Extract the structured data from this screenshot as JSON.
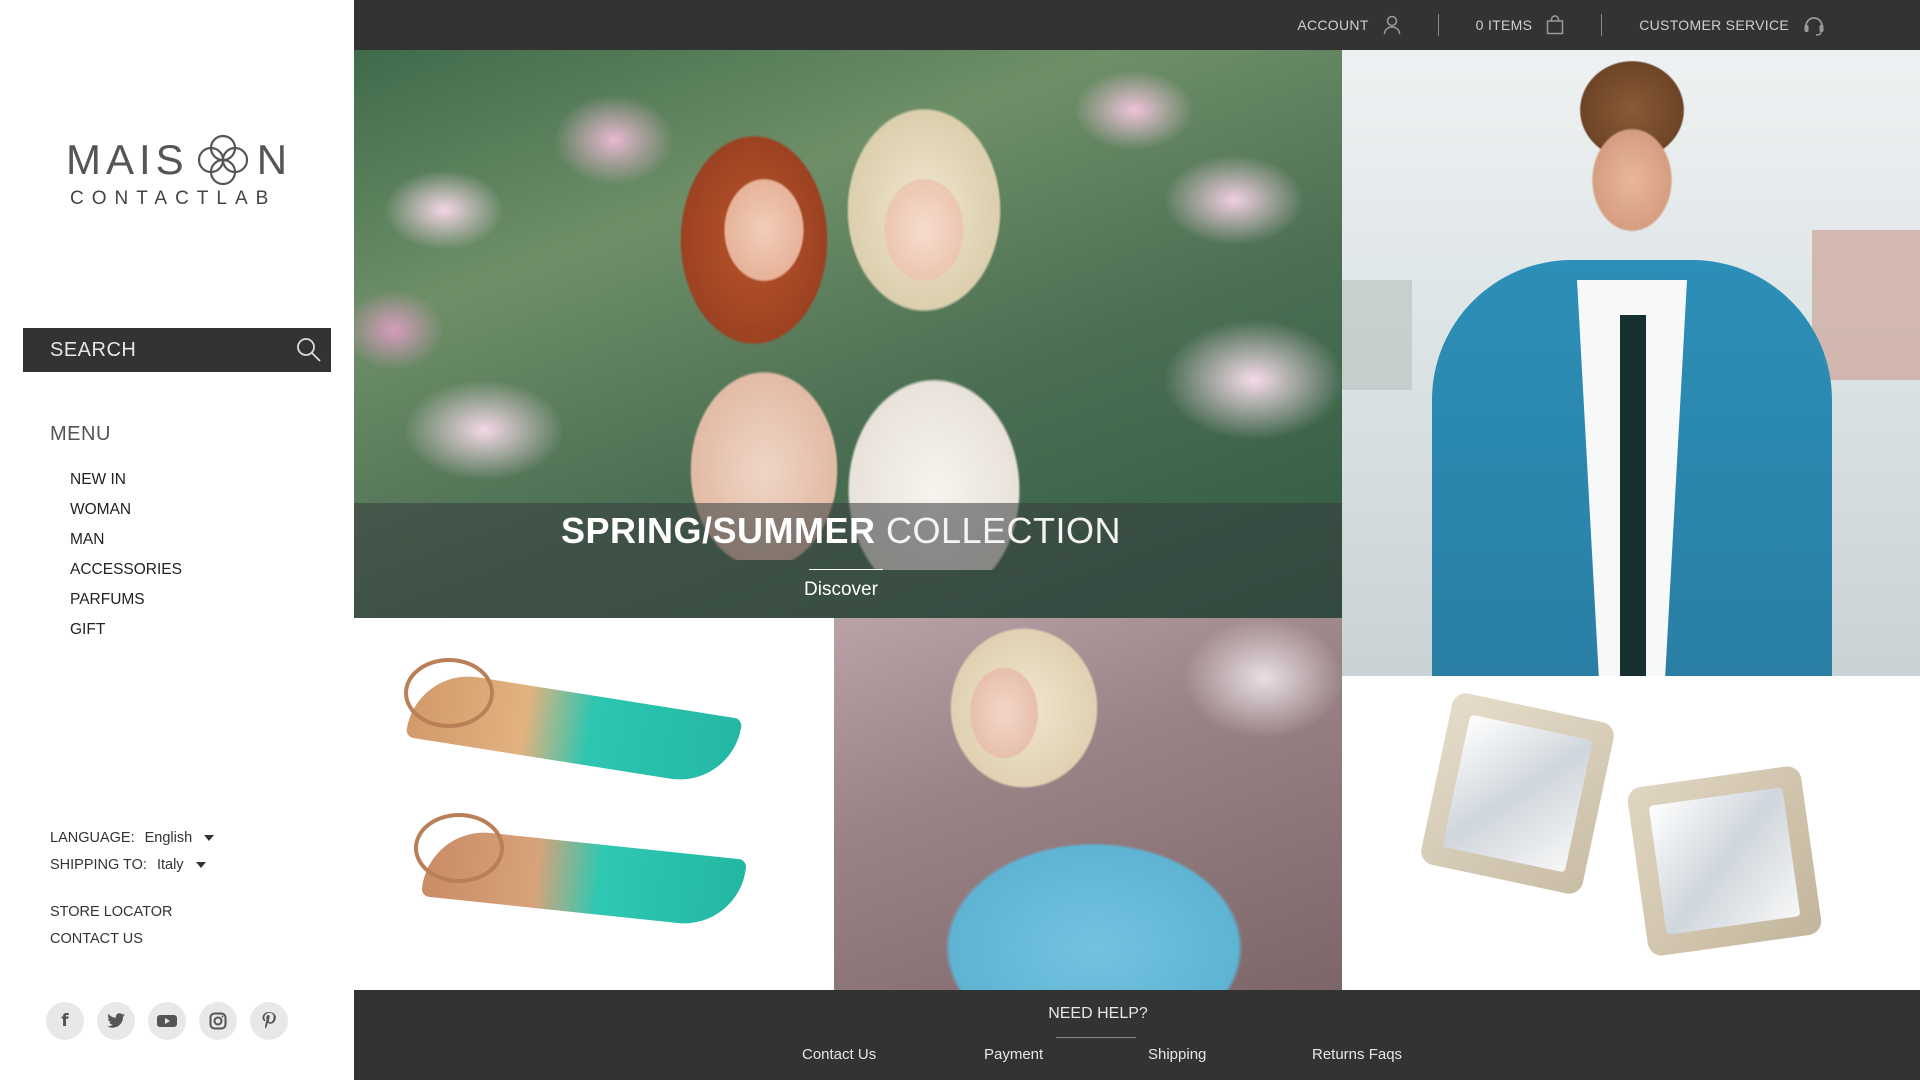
{
  "brand": {
    "name_main": "MAIS",
    "name_end": "N",
    "name_sub": "CONTACTLAB"
  },
  "search": {
    "label": "SEARCH"
  },
  "menu": {
    "title": "MENU",
    "items": [
      "NEW IN",
      "WOMAN",
      "MAN",
      "ACCESSORIES",
      "PARFUMS",
      "GIFT"
    ]
  },
  "prefs": {
    "language_label": "LANGUAGE:",
    "language_value": "English",
    "shipping_label": "SHIPPING TO:",
    "shipping_value": "Italy"
  },
  "links": {
    "store_locator": "STORE LOCATOR",
    "contact_us": "CONTACT US"
  },
  "social": [
    "facebook-icon",
    "twitter-icon",
    "youtube-icon",
    "instagram-icon",
    "pinterest-icon"
  ],
  "topnav": {
    "account": "ACCOUNT",
    "items": "0 ITEMS",
    "customer_service": "CUSTOMER SERVICE"
  },
  "hero": {
    "title_bold": "SPRING/SUMMER",
    "title_light": "COLLECTION",
    "cta": "Discover"
  },
  "footer": {
    "help_title": "NEED HELP?",
    "links": [
      "Contact Us",
      "Payment",
      "Shipping",
      "Returns Faqs"
    ]
  },
  "colors": {
    "dark": "#333333",
    "sidebar_bg": "#ffffff",
    "text": "#333333"
  }
}
